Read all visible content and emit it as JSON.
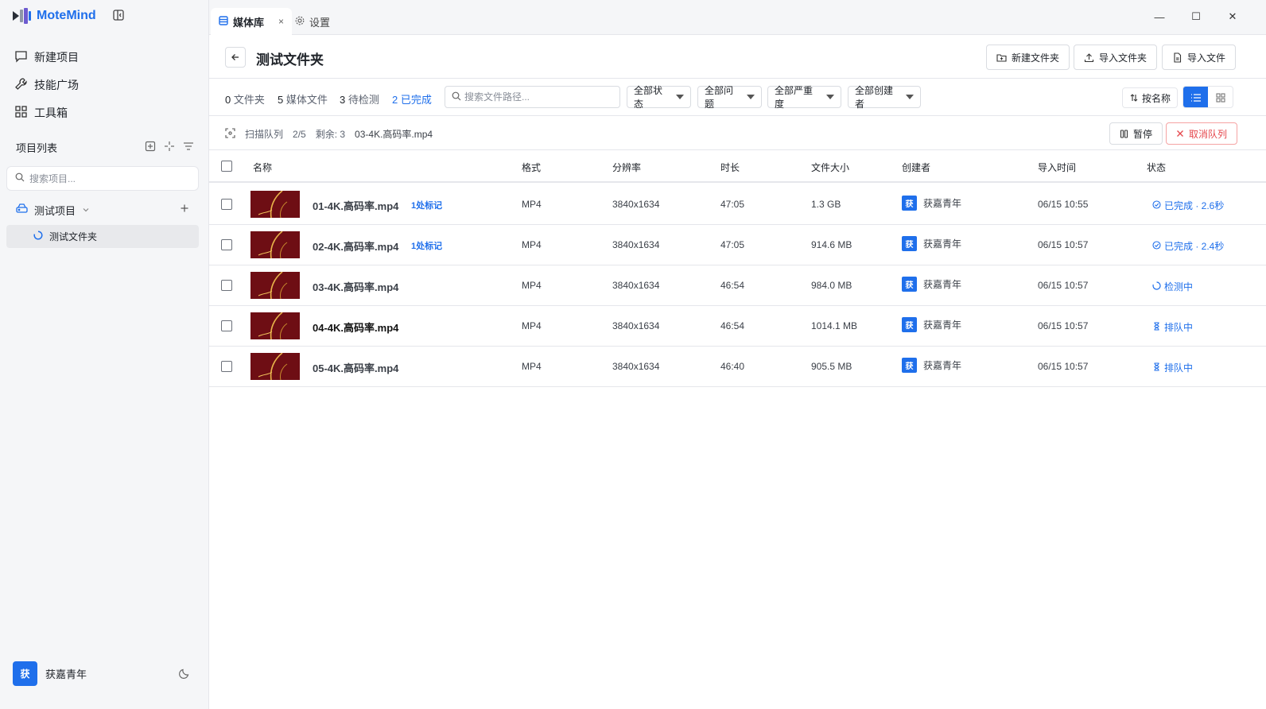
{
  "brand": {
    "name": "MoteMind"
  },
  "sidebar": {
    "nav": [
      {
        "label": "新建项目",
        "icon": "chat-icon"
      },
      {
        "label": "技能广场",
        "icon": "wrench-icon"
      },
      {
        "label": "工具箱",
        "icon": "grid-icon"
      }
    ],
    "section_title": "项目列表",
    "search_placeholder": "搜索项目...",
    "project": {
      "label": "测试项目"
    },
    "folder": {
      "label": "测试文件夹"
    },
    "user": {
      "avatar_text": "获",
      "name": "获嘉青年"
    }
  },
  "tabs": [
    {
      "label": "媒体库",
      "close": "×"
    },
    {
      "label": "设置"
    }
  ],
  "window_controls": {
    "minimize": "—",
    "maximize": "☐",
    "close": "✕"
  },
  "header": {
    "title": "测试文件夹",
    "buttons": {
      "new_folder": "新建文件夹",
      "import_folder": "导入文件夹",
      "import_file": "导入文件"
    }
  },
  "filters": {
    "stats": [
      {
        "count": "0",
        "label": "文件夹"
      },
      {
        "count": "5",
        "label": "媒体文件"
      },
      {
        "count": "3",
        "label": "待检测"
      },
      {
        "count": "2",
        "label": "已完成"
      }
    ],
    "search_placeholder": "搜索文件路径...",
    "selects": [
      "全部状态",
      "全部问题",
      "全部严重度",
      "全部创建者"
    ],
    "sort_label": "按名称"
  },
  "queue": {
    "label": "扫描队列",
    "progress": "2/5",
    "remaining": "剩余: 3",
    "current": "03-4K.高码率.mp4",
    "pause_label": "暂停",
    "cancel_label": "取消队列"
  },
  "table": {
    "columns": [
      "名称",
      "格式",
      "分辨率",
      "时长",
      "文件大小",
      "创建者",
      "导入时间",
      "状态"
    ],
    "rows": [
      {
        "name": "01-4K.高码率.mp4",
        "mark": "1处标记",
        "format": "MP4",
        "resolution": "3840x1634",
        "duration": "47:05",
        "size": "1.3 GB",
        "creator_avatar": "获",
        "creator": "获嘉青年",
        "imported": "06/15 10:55",
        "status": "已完成 · 2.6秒",
        "status_icon": "check-circle-icon"
      },
      {
        "name": "02-4K.高码率.mp4",
        "mark": "1处标记",
        "format": "MP4",
        "resolution": "3840x1634",
        "duration": "47:05",
        "size": "914.6 MB",
        "creator_avatar": "获",
        "creator": "获嘉青年",
        "imported": "06/15 10:57",
        "status": "已完成 · 2.4秒",
        "status_icon": "check-circle-icon"
      },
      {
        "name": "03-4K.高码率.mp4",
        "mark": "",
        "format": "MP4",
        "resolution": "3840x1634",
        "duration": "46:54",
        "size": "984.0 MB",
        "creator_avatar": "获",
        "creator": "获嘉青年",
        "imported": "06/15 10:57",
        "status": "检测中",
        "status_icon": "spinner-icon"
      },
      {
        "name": "04-4K.高码率.mp4",
        "mark": "",
        "format": "MP4",
        "resolution": "3840x1634",
        "duration": "46:54",
        "size": "1014.1 MB",
        "creator_avatar": "获",
        "creator": "获嘉青年",
        "imported": "06/15 10:57",
        "status": "排队中",
        "status_icon": "hourglass-icon"
      },
      {
        "name": "05-4K.高码率.mp4",
        "mark": "",
        "format": "MP4",
        "resolution": "3840x1634",
        "duration": "46:40",
        "size": "905.5 MB",
        "creator_avatar": "获",
        "creator": "获嘉青年",
        "imported": "06/15 10:57",
        "status": "排队中",
        "status_icon": "hourglass-icon"
      }
    ]
  },
  "colors": {
    "accent": "#1f6feb",
    "danger": "#e5484d",
    "thumb": "#6e0e14"
  }
}
